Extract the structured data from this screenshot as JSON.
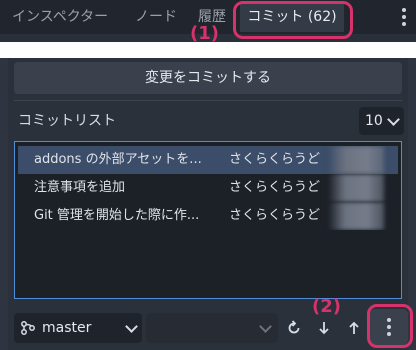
{
  "tabs": {
    "inspector": "インスペクター",
    "node": "ノード",
    "history": "履歴",
    "commit": "コミット (62)"
  },
  "commit_button": "変更をコミットする",
  "commit_list": {
    "label": "コミットリスト",
    "count": "10",
    "rows": [
      {
        "message": "addons の外部アセットを...",
        "author": "さくらくらうど"
      },
      {
        "message": "注意事項を追加",
        "author": "さくらくらうど"
      },
      {
        "message": "Git 管理を開始した際に作...",
        "author": "さくらくらうど"
      }
    ]
  },
  "toolbar": {
    "branch": "master",
    "remote": "",
    "icons": [
      "branch-icon",
      "refresh-icon",
      "pull-icon",
      "push-icon",
      "more-vertical-icon"
    ]
  },
  "annotations": {
    "label_1": "(1)",
    "label_2": "(2)",
    "color": "#d6336c"
  }
}
